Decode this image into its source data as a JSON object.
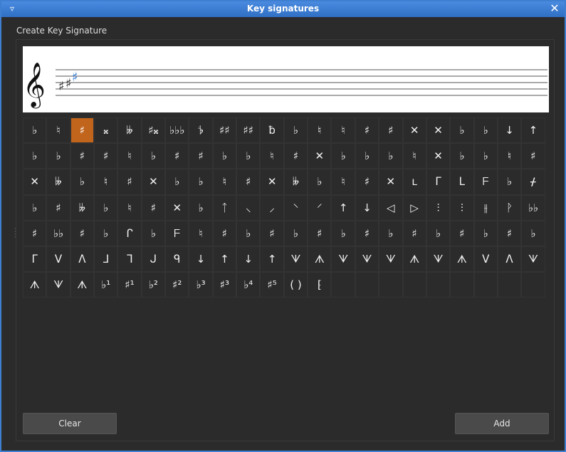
{
  "window": {
    "title": "Key signatures",
    "menu_icon": "▿",
    "close_icon": "✕"
  },
  "header": {
    "label": "Create Key Signature"
  },
  "staff": {
    "clef": "𝄞",
    "accidentals": [
      "♯",
      "♯",
      "♯"
    ]
  },
  "palette": {
    "selected_index": 2,
    "cells": [
      "♭",
      "♮",
      "♯",
      "𝄪",
      "𝄫",
      "♯𝄪",
      "♭♭♭",
      "𝄳",
      "♯♯",
      "♯♯",
      "ƀ",
      "♭",
      "♮",
      "♮",
      "♯",
      "♯",
      "✕",
      "✕",
      "♭",
      "♭",
      "↓",
      "↑",
      "♭",
      "♭",
      "♯",
      "♯",
      "♮",
      "♭",
      "♯",
      "♯",
      "♭",
      "♭",
      "♮",
      "♯",
      "✕",
      "♭",
      "♭",
      "♭",
      "♮",
      "✕",
      "♭",
      "♭",
      "♮",
      "♯",
      "✕",
      "𝄫",
      "♭",
      "♮",
      "♯",
      "✕",
      "♭",
      "♭",
      "♮",
      "♯",
      "✕",
      "𝄫",
      "♭",
      "♮",
      "♯",
      "✕",
      "ʟ",
      "ᒥ",
      "ᒪ",
      "ᖴ",
      "♭",
      "ᚋ",
      "♭",
      "♯",
      "𝄫",
      "♭",
      "♮",
      "♯",
      "✕",
      "♭",
      "ᛏ",
      "⸜",
      "⸝",
      "⸌",
      "⸍",
      "↑",
      "↓",
      "◁",
      "▷",
      "⫶",
      "⫶",
      "⫲",
      "ᚹ",
      "♭♭",
      "♯",
      "♭♭",
      "♯",
      "♭",
      "ᒋ",
      "♭",
      "ᖴ",
      "♮",
      "♯",
      "♭",
      "♯",
      "♭",
      "♯",
      "♭",
      "♯",
      "♭",
      "♯",
      "♭",
      "♯",
      "♭",
      "♯",
      "♭",
      "ᒥ",
      "ᐯ",
      "ᐱ",
      "ᒧ",
      "ᒣ",
      "ᒍ",
      "ᑫ",
      "↓",
      "↑",
      "↓",
      "↑",
      "ᗐ",
      "ᗑ",
      "ᗐ",
      "ᗐ",
      "ᗐ",
      "ᗑ",
      "ᗐ",
      "ᗑ",
      "ᐯ",
      "ᐱ",
      "ᗐ",
      "ᗑ",
      "ᗐ",
      "ᗑ",
      "♭¹",
      "♯¹",
      "♭²",
      "♯²",
      "♭³",
      "♯³",
      "♭⁴",
      "♯⁵",
      "( )",
      "⁅",
      "",
      "",
      "",
      "",
      "",
      "",
      "",
      "",
      ""
    ]
  },
  "buttons": {
    "clear": "Clear",
    "add": "Add"
  }
}
